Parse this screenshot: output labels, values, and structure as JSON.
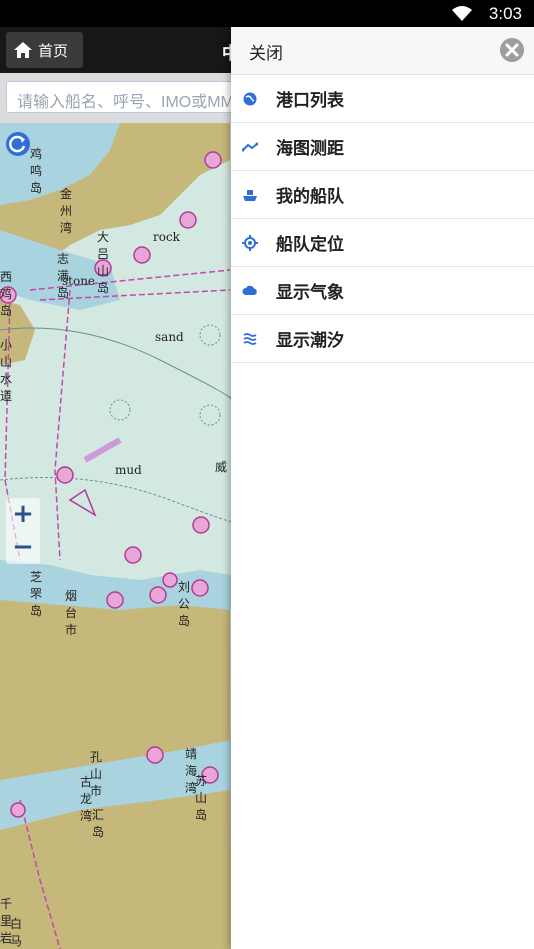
{
  "status_bar": {
    "time": "3:03"
  },
  "app_bar": {
    "home_label": "首页",
    "title": "中"
  },
  "search": {
    "placeholder": "请输入船名、呼号、IMO或MMSI"
  },
  "map": {
    "labels": [
      "鸡鸣岛",
      "金州湾",
      "大吕山岛",
      "志满岛",
      "西鸡岛",
      "小山水道",
      "sand",
      "mud",
      "rock",
      "stone",
      "威",
      "芝罘岛",
      "烟台市",
      "刘公岛",
      "孔山市",
      "古龙湾",
      "靖海湾",
      "苏山岛",
      "汇岛",
      "千里岩",
      "白马"
    ],
    "zoom_in": "+",
    "zoom_out": "−"
  },
  "drawer": {
    "close_label": "关闭",
    "items": [
      {
        "label": "港口列表",
        "icon": "globe-icon"
      },
      {
        "label": "海图测距",
        "icon": "ruler-line-icon"
      },
      {
        "label": "我的船队",
        "icon": "ship-icon"
      },
      {
        "label": "船队定位",
        "icon": "locate-icon"
      },
      {
        "label": "显示气象",
        "icon": "cloud-icon"
      },
      {
        "label": "显示潮汐",
        "icon": "tide-icon"
      }
    ]
  },
  "colors": {
    "accent": "#2f6fd6",
    "land": "#c6b77a",
    "shallow": "#a9d3de",
    "sea": "#d3e8e0",
    "magenta": "#c24aa8"
  }
}
